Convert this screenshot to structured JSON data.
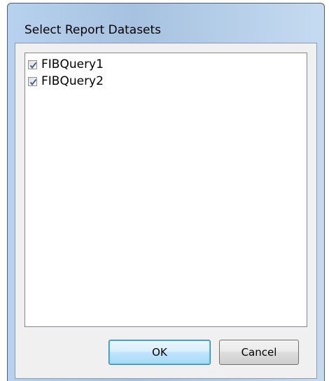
{
  "window": {
    "title": "Select Report Datasets"
  },
  "datasets": {
    "items": [
      {
        "label": "FIBQuery1",
        "checked": true
      },
      {
        "label": "FIBQuery2",
        "checked": true
      }
    ]
  },
  "buttons": {
    "ok_label": "OK",
    "cancel_label": "Cancel"
  },
  "icons": {
    "checkbox": "checkmark-icon"
  },
  "colors": {
    "checkmark": "#4a5f97",
    "default_button_border": "#3c7fb1"
  }
}
